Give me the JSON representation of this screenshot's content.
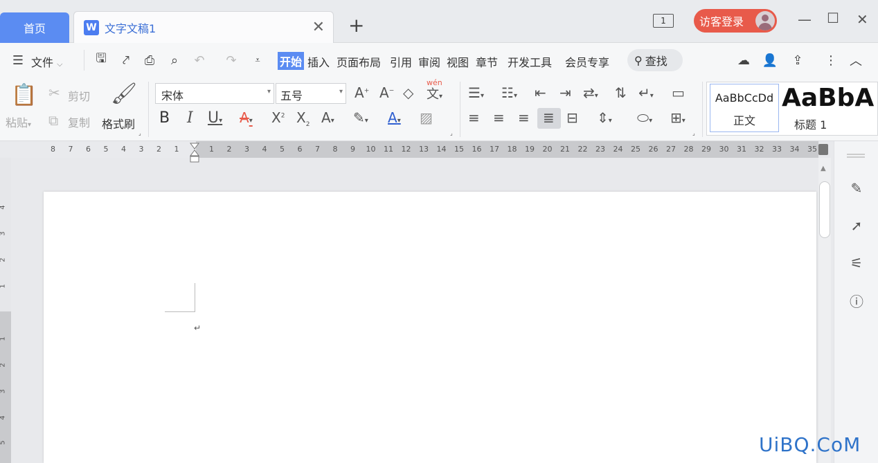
{
  "titlebar": {
    "home_tab": "首页",
    "doc_tab": "文字文稿1",
    "doc_icon": "W",
    "window_count": "1",
    "guest_login": "访客登录"
  },
  "menu": {
    "file": "文件",
    "items": [
      "开始",
      "插入",
      "页面布局",
      "引用",
      "审阅",
      "视图",
      "章节",
      "开发工具",
      "会员专享"
    ],
    "active": "开始",
    "search": "查找"
  },
  "ribbon": {
    "paste": "粘贴",
    "cut": "剪切",
    "copy": "复制",
    "format_painter": "格式刷",
    "font_name": "宋体",
    "font_size": "五号",
    "pinyin": "wén",
    "bold": "B",
    "italic": "I",
    "underline": "U",
    "styles": [
      {
        "sample": "AaBbCcDd",
        "name": "正文"
      },
      {
        "sample": "AaBbA",
        "name": "标题 1"
      }
    ]
  },
  "ruler": {
    "left_numbers": [
      "8",
      "7",
      "6",
      "5",
      "4",
      "3",
      "2",
      "1"
    ],
    "right_numbers": [
      "1",
      "2",
      "3",
      "4",
      "5",
      "6",
      "7",
      "8",
      "9",
      "10",
      "11",
      "12",
      "13",
      "14",
      "15",
      "16",
      "17",
      "18",
      "19",
      "20",
      "21",
      "22",
      "23",
      "24",
      "25",
      "26",
      "27",
      "28",
      "29",
      "30",
      "31",
      "32",
      "33",
      "34",
      "35"
    ],
    "vertical_numbers": [
      "4",
      "3",
      "2",
      "1",
      "1",
      "2",
      "3",
      "4",
      "5"
    ]
  },
  "document": {
    "paragraph_mark": "↵"
  },
  "watermark": "UiBQ.CoM",
  "colors": {
    "accent": "#5b8cf2",
    "guest": "#e85a4a",
    "link": "#3b6fd6"
  }
}
